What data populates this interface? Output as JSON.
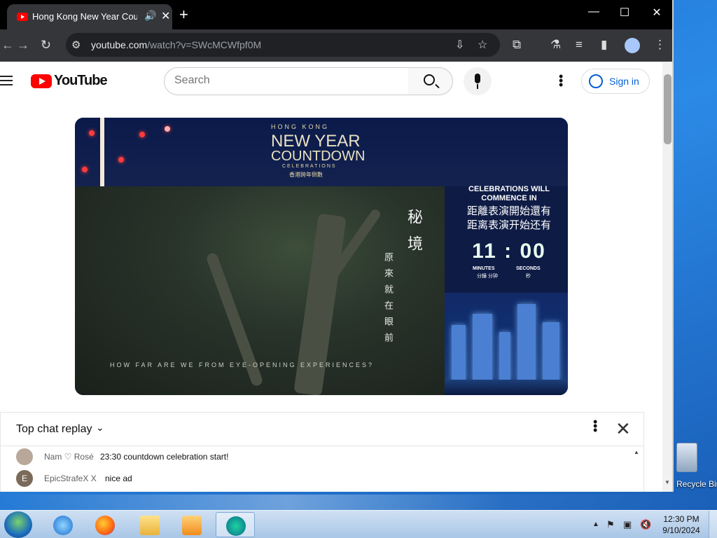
{
  "browser": {
    "tab_title": "Hong Kong New Year Countdown Celebrations",
    "new_tab": "+",
    "tab_close": "✕",
    "url_domain": "youtube.com",
    "url_path": "/watch?v=SWcMCWfpf0M",
    "window_minimize": "—",
    "window_maximize": "☐",
    "window_close": "✕"
  },
  "youtube": {
    "logo_text": "YouTube",
    "search_placeholder": "Search",
    "sign_in": "Sign in"
  },
  "video": {
    "hk_label": "HONG KONG",
    "new_year": "NEW YEAR",
    "countdown": "COUNTDOWN",
    "celebrations": "CELEBRATIONS",
    "celebrations_zh": "香港跨年倒數",
    "commence_en": "CELEBRATIONS WILL COMMENCE IN",
    "commence_zh_trad": "距離表演開始還有",
    "commence_zh_simp": "距离表演开始还有",
    "timer": "11 : 00",
    "minutes_en": "MINUTES",
    "minutes_zh": "分鐘 分钟",
    "seconds_en": "SECONDS",
    "seconds_zh": "秒",
    "vertical_title": "秘境",
    "vertical_sub": "原來就在眼前",
    "caption": "HOW FAR ARE WE FROM EYE-OPENING EXPERIENCES?"
  },
  "chat": {
    "header": "Top chat replay",
    "messages": [
      {
        "initial": "",
        "author": "Nam ♡ Rosé",
        "text": "23:30 countdown celebration start!"
      },
      {
        "initial": "E",
        "author": "EpicStrafeX X",
        "text": "nice ad"
      }
    ]
  },
  "desktop": {
    "recycle_bin_label": "Recycle Bin"
  },
  "taskbar": {
    "time": "12:30 PM",
    "date": "9/10/2024"
  },
  "colors": {
    "youtube_red": "#ff0000",
    "link_blue": "#065fd4",
    "chrome_dark": "#35363a"
  }
}
